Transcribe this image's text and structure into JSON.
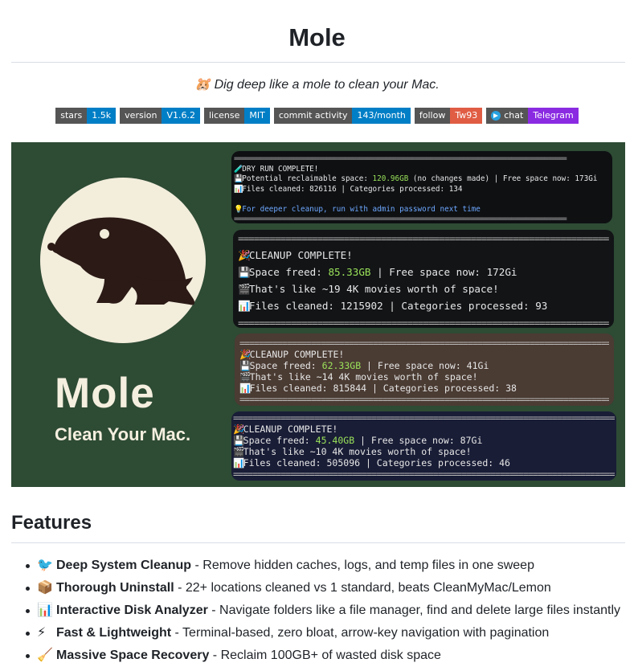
{
  "title": "Mole",
  "tagline": "🐹 Dig deep like a mole to clean your Mac.",
  "badges": [
    {
      "label": "stars",
      "value": "1.5k",
      "color": "#007ec6"
    },
    {
      "label": "version",
      "value": "V1.6.2",
      "color": "#007ec6"
    },
    {
      "label": "license",
      "value": "MIT",
      "color": "#007ec6"
    },
    {
      "label": "commit activity",
      "value": "143/month",
      "color": "#007ec6"
    },
    {
      "label": "follow",
      "value": "Tw93",
      "color": "#e05d44"
    },
    {
      "label": "chat",
      "value": "Telegram",
      "color": "#8a2be2"
    }
  ],
  "hero": {
    "brand_name": "Mole",
    "brand_tagline": "Clean Your Mac.",
    "separator": "==========================================================================================",
    "terminals": [
      {
        "lines": [
          {
            "icon": "🧪",
            "parts": [
              "DRY RUN COMPLETE!"
            ]
          },
          {
            "icon": "💾",
            "parts": [
              "Potential reclaimable space: ",
              "120.96GB",
              " (no changes made) | Free space now: 173Gi"
            ]
          },
          {
            "icon": "📊",
            "parts": [
              "Files cleaned: 826116 | Categories processed: 134"
            ]
          },
          {
            "icon": "",
            "parts": [
              ""
            ]
          },
          {
            "icon": "💡",
            "parts": [
              "For deeper cleanup, run with admin password next time"
            ]
          }
        ]
      },
      {
        "lines": [
          {
            "icon": "🎉",
            "parts": [
              "CLEANUP COMPLETE!"
            ]
          },
          {
            "icon": "💾",
            "parts": [
              "Space freed: ",
              "85.33GB",
              " | Free space now: 172Gi"
            ]
          },
          {
            "icon": "🎬",
            "parts": [
              "That's like ~19 4K movies worth of space!"
            ]
          },
          {
            "icon": "📊",
            "parts": [
              "Files cleaned: 1215902 | Categories processed: 93"
            ]
          }
        ]
      },
      {
        "lines": [
          {
            "icon": "🎉",
            "parts": [
              "CLEANUP COMPLETE!"
            ]
          },
          {
            "icon": "💾",
            "parts": [
              "Space freed: ",
              "62.33GB",
              " | Free space now: 41Gi"
            ]
          },
          {
            "icon": "🎬",
            "parts": [
              "That's like ~14 4K movies worth of space!"
            ]
          },
          {
            "icon": "📊",
            "parts": [
              "Files cleaned: 815844 | Categories processed: 38"
            ]
          }
        ]
      },
      {
        "lines": [
          {
            "icon": "🎉",
            "parts": [
              "CLEANUP COMPLETE!"
            ]
          },
          {
            "icon": "💾",
            "parts": [
              "Space freed: ",
              "45.40GB",
              " | Free space now: 87Gi"
            ]
          },
          {
            "icon": "🎬",
            "parts": [
              "That's like ~10 4K movies worth of space!"
            ]
          },
          {
            "icon": "📊",
            "parts": [
              "Files cleaned: 505096 | Categories processed: 46"
            ]
          }
        ]
      }
    ]
  },
  "features": {
    "heading": "Features",
    "items": [
      {
        "emoji": "🐦",
        "name": "Deep System Cleanup",
        "desc": " - Remove hidden caches, logs, and temp files in one sweep"
      },
      {
        "emoji": "📦",
        "name": "Thorough Uninstall",
        "desc": " - 22+ locations cleaned vs 1 standard, beats CleanMyMac/Lemon"
      },
      {
        "emoji": "📊",
        "name": "Interactive Disk Analyzer",
        "desc": " - Navigate folders like a file manager, find and delete large files instantly"
      },
      {
        "emoji": "⚡",
        "name": "Fast & Lightweight",
        "desc": " - Terminal-based, zero bloat, arrow-key navigation with pagination"
      },
      {
        "emoji": "🧹",
        "name": "Massive Space Recovery",
        "desc": " - Reclaim 100GB+ of wasted disk space"
      }
    ]
  }
}
